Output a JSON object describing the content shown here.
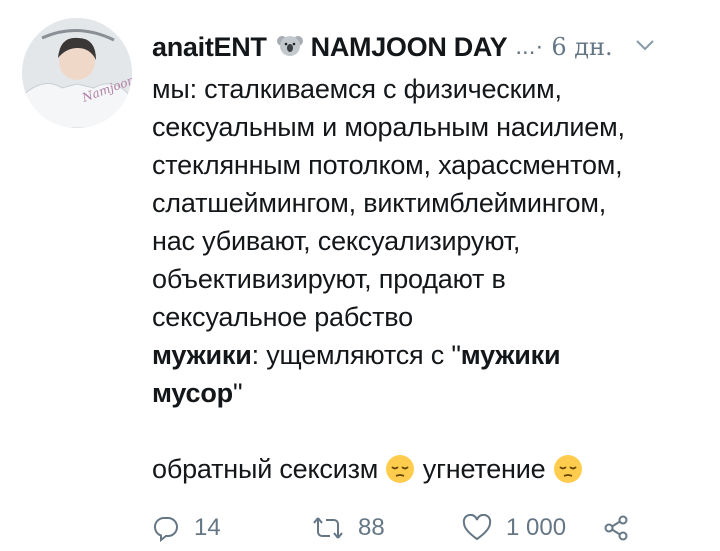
{
  "tweet": {
    "display_name": "anaitENT",
    "name_suffix": "NAMJOON DAY",
    "ellipsis": "...·",
    "time": "6 дн.",
    "lines": [
      "мы: сталкиваемся с физическим,",
      "сексуальным и моральным насилием,",
      "стеклянным потолком, харассментом,",
      "слатшеймингом, виктимблеймингом,",
      "нас убивают, сексуализируют,",
      "объективизируют, продают в",
      "сексуальное рабство"
    ],
    "reply_line": {
      "bold1": "мужики",
      "text1": ": ущемляются с \"",
      "bold2": "мужики",
      "bold3": "мусор",
      "text2": "\""
    },
    "final_line": {
      "text1": "обратный сексизм",
      "text2": "угнетение"
    },
    "avatar_text": "Namjoon Day"
  },
  "actions": {
    "reply_count": "14",
    "retweet_count": "88",
    "like_count": "1 000"
  },
  "colors": {
    "text": "#14171a",
    "muted": "#657786",
    "emoji": "#ffcc4d"
  },
  "icons": [
    "koala-emoji-icon",
    "chevron-down-icon",
    "pensive-emoji-icon",
    "reply-icon",
    "retweet-icon",
    "like-icon",
    "share-icon"
  ]
}
